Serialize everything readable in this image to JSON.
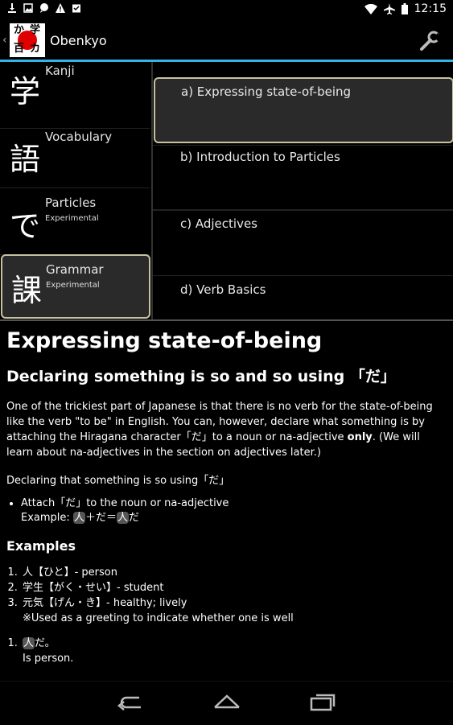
{
  "status": {
    "time": "12:15"
  },
  "actionbar": {
    "title": "Obenkyo",
    "logo_chars": [
      "か",
      "学",
      "百",
      "カ"
    ]
  },
  "sidebar": {
    "items": [
      {
        "kanji": "学",
        "label": "Kanji",
        "sub": ""
      },
      {
        "kanji": "語",
        "label": "Vocabulary",
        "sub": ""
      },
      {
        "kanji": "で",
        "label": "Particles",
        "sub": "Experimental"
      },
      {
        "kanji": "課",
        "label": "Grammar",
        "sub": "Experimental"
      }
    ]
  },
  "lessons": [
    {
      "label": "a) Expressing state-of-being"
    },
    {
      "label": "b) Introduction to Particles"
    },
    {
      "label": "c) Adjectives"
    },
    {
      "label": "d) Verb Basics"
    }
  ],
  "article": {
    "title": "Expressing state-of-being",
    "subtitle": "Declaring something is so and so using 「だ」",
    "intro_a": "One of the trickiest part of Japanese is that there is no verb for the state-of-being like the verb \"to be\" in English. You can, however, declare what something is by attaching the Hiragana character「だ」to a noun or na-adjective ",
    "intro_bold": "only",
    "intro_b": ". (We will learn about na-adjectives in the section on adjectives later.)",
    "declaring": "Declaring that something is so using「だ」",
    "bullet_line1": "Attach「だ」to the noun or na-adjective",
    "bullet_example_label": "Example: ",
    "bullet_ex_hl1": "人",
    "bullet_ex_mid": "＋だ＝",
    "bullet_ex_hl2": "人",
    "bullet_ex_end": "だ",
    "examples_heading": "Examples",
    "examples": [
      "人【ひと】- person",
      "学生【がく・せい】- student",
      "元気【げん・き】- healthy; lively"
    ],
    "examples_note": "※Used as a greeting to indicate whether one is well",
    "sentence_hl": "人",
    "sentence_rest": "だ。",
    "sentence_translation": "Is person."
  }
}
